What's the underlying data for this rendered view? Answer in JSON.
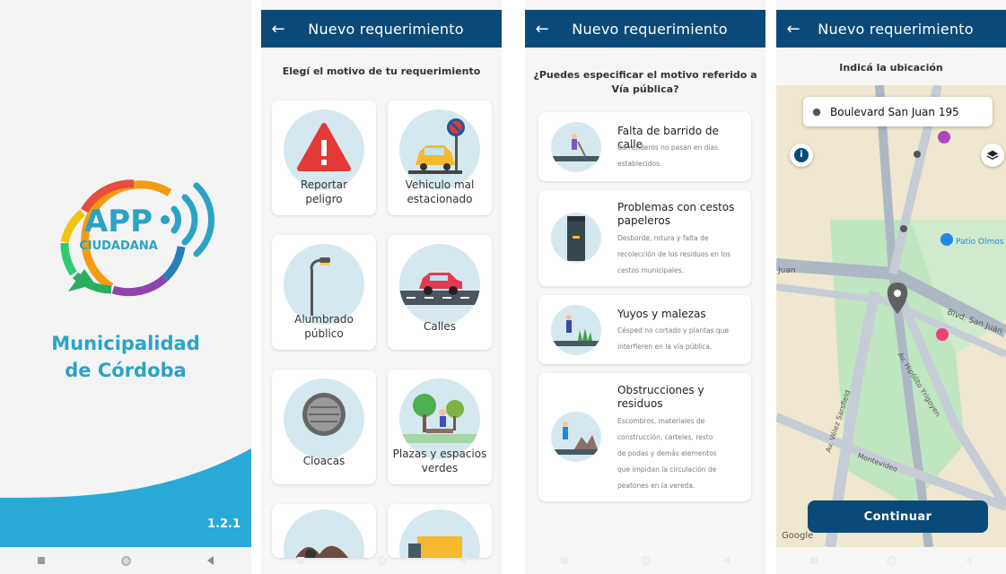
{
  "splash": {
    "logo_app": "APP",
    "logo_sub": "CIUDADANA",
    "brand_line1": "Municipalidad",
    "brand_line2": "de Córdoba",
    "version": "1.2.1"
  },
  "screen2": {
    "title": "Nuevo requerimiento",
    "subtitle": "Elegí el motivo de tu requerimiento",
    "categories": [
      {
        "label_line1": "Reportar",
        "label_line2": "peligro",
        "icon": "warning-icon"
      },
      {
        "label_line1": "Vehiculo mal",
        "label_line2": "estacionado",
        "icon": "parked-car-icon"
      },
      {
        "label_line1": "Alumbrado",
        "label_line2": "público",
        "icon": "street-light-icon"
      },
      {
        "label_line1": "Calles",
        "label_line2": "",
        "icon": "car-street-icon"
      },
      {
        "label_line1": "Cloacas",
        "label_line2": "",
        "icon": "manhole-icon"
      },
      {
        "label_line1": "Plazas y espacios",
        "label_line2": "verdes",
        "icon": "park-icon"
      }
    ]
  },
  "screen3": {
    "title": "Nuevo requerimiento",
    "question_line1": "¿Puedes especificar el motivo referido a",
    "question_line2": "Vía pública?",
    "items": [
      {
        "title_line1": "Falta de barrido de calle",
        "title_line2": "",
        "desc": [
          "Barrenderos no pasan en días",
          "establecidos."
        ]
      },
      {
        "title_line1": "Problemas con cestos",
        "title_line2": "papeleros",
        "desc": [
          "Desborde, rotura y falta de",
          "recolección de los residuos en los",
          "cestos municipales."
        ]
      },
      {
        "title_line1": "Yuyos y malezas",
        "title_line2": "",
        "desc": [
          "Césped no cortado y plantas que",
          "interfieren en la vía pública."
        ]
      },
      {
        "title_line1": "Obstrucciones y",
        "title_line2": "residuos",
        "desc": [
          "Escombros, materiales de",
          "construcción, carteles, resto",
          "de podas y demás elementos",
          "que impidan la circulación de",
          "peatones en la vereda."
        ]
      }
    ]
  },
  "screen4": {
    "title": "Nuevo requerimiento",
    "subtitle": "Indicá la ubicación",
    "address": "Boulevard San Juan 195",
    "map_labels": {
      "patio": "Patio Olmos",
      "blvd": "Blvd. San Juan",
      "juan": "Juan",
      "hipolito": "Av. Hipólito Yrigoyen",
      "velez": "Av. Vélez Sarsfield",
      "montevideo": "Montevideo",
      "google": "Google"
    },
    "button": "Continuar"
  },
  "colors": {
    "primary": "#0b4a78",
    "accent": "#2ba3c6",
    "wave": "#29a9d6"
  }
}
